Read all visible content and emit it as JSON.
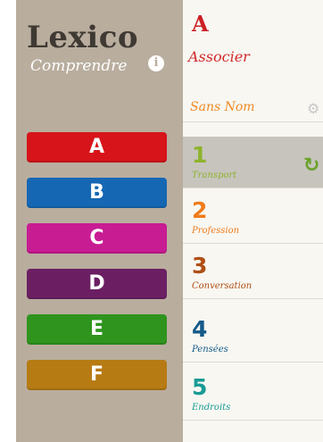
{
  "sidebar": {
    "title": "Lexico",
    "subtitle": "Comprendre",
    "info_icon": "i",
    "letters": [
      {
        "label": "A",
        "color": "#d7141a"
      },
      {
        "label": "B",
        "color": "#1667b3"
      },
      {
        "label": "C",
        "color": "#c81c93"
      },
      {
        "label": "D",
        "color": "#6b1f62"
      },
      {
        "label": "E",
        "color": "#2f941e"
      },
      {
        "label": "F",
        "color": "#b77b14"
      }
    ]
  },
  "panel": {
    "letter": "A",
    "subtitle": "Associer",
    "sans_nom": "Sans Nom",
    "gear_icon": "⚙",
    "refresh_icon": "↻",
    "categories": [
      {
        "num": "1",
        "label": "Transport",
        "color": "#8db32c"
      },
      {
        "num": "2",
        "label": "Profession",
        "color": "#ef7c1b"
      },
      {
        "num": "3",
        "label": "Conversation",
        "color": "#b04e14"
      },
      {
        "num": "4",
        "label": "Pensées",
        "color": "#145a88"
      },
      {
        "num": "5",
        "label": "Endroits",
        "color": "#1a9b95"
      }
    ]
  }
}
